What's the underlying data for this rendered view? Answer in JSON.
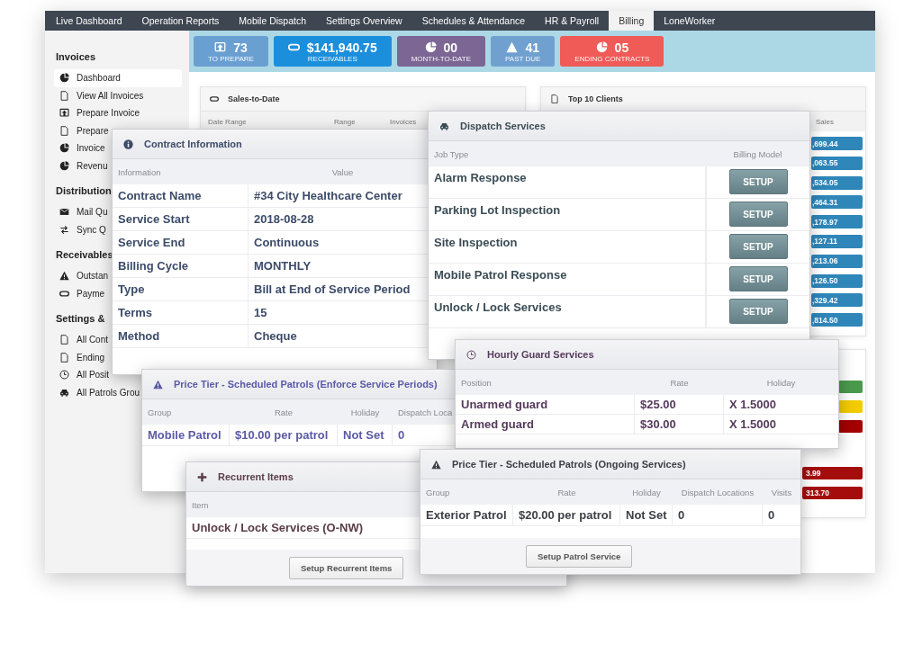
{
  "tabs": [
    {
      "label": "Live Dashboard",
      "selected": false
    },
    {
      "label": "Operation Reports",
      "selected": false
    },
    {
      "label": "Mobile Dispatch",
      "selected": false
    },
    {
      "label": "Settings Overview",
      "selected": false
    },
    {
      "label": "Schedules & Attendance",
      "selected": false
    },
    {
      "label": "HR & Payroll",
      "selected": false
    },
    {
      "label": "Billing",
      "selected": true
    },
    {
      "label": "LoneWorker",
      "selected": false
    }
  ],
  "sidebar": {
    "sections": [
      {
        "title": "Invoices",
        "items": [
          {
            "label": "Dashboard",
            "selected": true
          },
          {
            "label": "View All Invoices",
            "selected": false
          },
          {
            "label": "Prepare Invoice",
            "selected": false
          },
          {
            "label": "Prepare",
            "selected": false
          },
          {
            "label": "Invoice",
            "selected": false
          },
          {
            "label": "Revenu",
            "selected": false
          }
        ]
      },
      {
        "title": "Distribution",
        "items": [
          {
            "label": "Mail Qu",
            "selected": false
          },
          {
            "label": "Sync Q",
            "selected": false
          }
        ]
      },
      {
        "title": "Receivables",
        "items": [
          {
            "label": "Outstan",
            "selected": false
          },
          {
            "label": "Payme",
            "selected": false
          }
        ]
      },
      {
        "title": "Settings &",
        "items": [
          {
            "label": "All Cont",
            "selected": false
          },
          {
            "label": "Ending",
            "selected": false
          },
          {
            "label": "All Posit",
            "selected": false
          },
          {
            "label": "All Patrols Grou",
            "selected": false
          }
        ]
      }
    ]
  },
  "stats": [
    {
      "value": "73",
      "label": "TO PREPARE",
      "color": "#6a9fd2"
    },
    {
      "value": "$141,940.75",
      "label": "RECEIVABLES",
      "color": "#1b8fdc"
    },
    {
      "value": "00",
      "label": "MONTH-TO-DATE",
      "color": "#7b6694"
    },
    {
      "value": "41",
      "label": "PAST DUE",
      "color": "#6fa0d0"
    },
    {
      "value": "05",
      "label": "ENDING CONTRACTS",
      "color": "#f05a57"
    }
  ],
  "sales_to_date": {
    "title": "Sales-to-Date",
    "columns": [
      "Date Range",
      "Range",
      "Invoices"
    ]
  },
  "top_clients": {
    "title": "Top 10 Clients",
    "column": "Sales",
    "values": [
      ",699.44",
      ",063.55",
      ",534.05",
      ",464.31",
      ",178.97",
      ",127.11",
      ",213.06",
      ",126.50",
      ",329.42",
      ",814.50"
    ]
  },
  "status_card": {
    "rows": [
      {
        "kind": "bar",
        "color": "#4a9a4c"
      },
      {
        "kind": "bar",
        "color": "#f2cc00"
      },
      {
        "kind": "bar",
        "color": "#a30000"
      },
      {
        "kind": "value",
        "text": "3.99",
        "color": "#a50d0d"
      },
      {
        "kind": "value",
        "text": "313.70",
        "color": "#a50d0d"
      }
    ]
  },
  "contract_information": {
    "title": "Contract Information",
    "columns": [
      "Information",
      "Value"
    ],
    "rows": [
      [
        "Contract Name",
        "#34 City Healthcare Center"
      ],
      [
        "Service Start",
        "2018-08-28"
      ],
      [
        "Service End",
        "Continuous"
      ],
      [
        "Billing Cycle",
        "MONTHLY"
      ],
      [
        "Type",
        "Bill at End of Service Period"
      ],
      [
        "Terms",
        "15"
      ],
      [
        "Method",
        "Cheque"
      ]
    ]
  },
  "dispatch_services": {
    "title": "Dispatch Services",
    "columns": [
      "Job Type",
      "Billing Model"
    ],
    "rows": [
      {
        "job": "Alarm Response",
        "button": "SETUP"
      },
      {
        "job": "Parking Lot Inspection",
        "button": "SETUP"
      },
      {
        "job": "Site Inspection",
        "button": "SETUP"
      },
      {
        "job": "Mobile Patrol Response",
        "button": "SETUP"
      },
      {
        "job": "Unlock / Lock Services",
        "button": "SETUP"
      }
    ]
  },
  "hourly_guard_services": {
    "title": "Hourly Guard Services",
    "columns": [
      "Position",
      "Rate",
      "Holiday"
    ],
    "rows": [
      [
        "Unarmed guard",
        "$25.00",
        "X 1.5000"
      ],
      [
        "Armed guard",
        "$30.00",
        "X 1.5000"
      ]
    ]
  },
  "price_tier_enforce": {
    "title": "Price Tier - Scheduled Patrols (Enforce Service Periods)",
    "columns": [
      "Group",
      "Rate",
      "Holiday",
      "Dispatch Loca"
    ],
    "rows": [
      [
        "Mobile Patrol",
        "$10.00 per patrol",
        "Not Set",
        "0"
      ]
    ]
  },
  "recurrent_items": {
    "title": "Recurrent Items",
    "columns": [
      "Item"
    ],
    "rows": [
      [
        "Unlock / Lock Services (O-NW)"
      ]
    ],
    "button": "Setup Recurrent Items"
  },
  "price_tier_ongoing": {
    "title": "Price Tier - Scheduled Patrols (Ongoing Services)",
    "columns": [
      "Group",
      "Rate",
      "Holiday",
      "Dispatch Locations",
      "Visits"
    ],
    "rows": [
      [
        "Exterior Patrol",
        "$20.00 per patrol",
        "Not Set",
        "0",
        "0"
      ]
    ],
    "button": "Setup Patrol Service"
  }
}
